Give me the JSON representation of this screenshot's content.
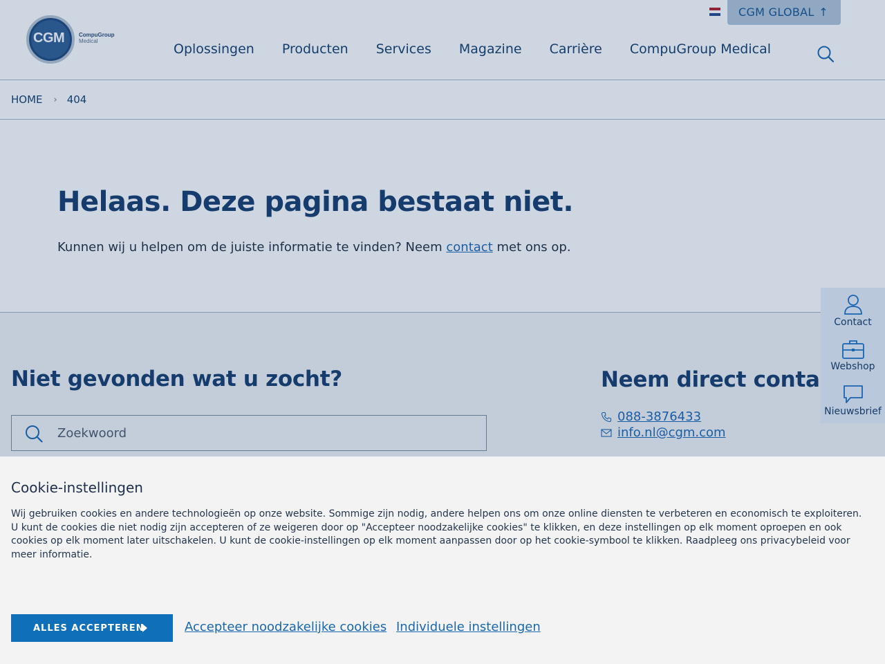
{
  "header": {
    "logo_text": "CGM",
    "logo_sub_1": "CompuGroup",
    "logo_sub_2": "Medical",
    "global_label": "CGM GLOBAL",
    "global_arrow": "↑",
    "nav": [
      {
        "label": "Oplossingen"
      },
      {
        "label": "Producten"
      },
      {
        "label": "Services"
      },
      {
        "label": "Magazine"
      },
      {
        "label": "Carrière"
      },
      {
        "label": "CompuGroup Medical"
      }
    ],
    "flag_colors": [
      "#ae1c28",
      "#ffffff",
      "#21468b"
    ]
  },
  "breadcrumb": {
    "home": "HOME",
    "separator": "›",
    "current": "404"
  },
  "hero": {
    "title": "Helaas. Deze pagina bestaat niet.",
    "text_before": "Kunnen wij u helpen om de juiste informatie te vinden? Neem ",
    "link": "contact",
    "text_after": " met ons op."
  },
  "search_section": {
    "title": "Niet gevonden wat u zocht?",
    "placeholder": "Zoekwoord"
  },
  "contact_section": {
    "title": "Neem direct contact op",
    "phone": "088-3876433",
    "email": "info.nl@cgm.com"
  },
  "side_panel": {
    "items": [
      {
        "label": "Contact",
        "icon": "person-icon"
      },
      {
        "label": "Webshop",
        "icon": "briefcase-icon"
      },
      {
        "label": "Nieuwsbrief",
        "icon": "chat-bubble-icon"
      }
    ]
  },
  "cookie": {
    "title": "Cookie-instellingen",
    "text": "Wij gebruiken cookies en andere technologieën op onze website. Sommige zijn nodig, andere helpen ons om onze online diensten te verbeteren en economisch te exploiteren. U kunt de cookies die niet nodig zijn accepteren of ze weigeren door op \"Accepteer noodzakelijke cookies\" te klikken, en deze instellingen op elk moment oproepen en ook cookies op elk moment later uitschakelen. U kunt de cookie-instellingen op elk moment aanpassen door op het cookie-symbool te klikken. Raadpleeg ons privacybeleid voor meer informatie.",
    "accept_all": "ALLES ACCEPTEREN",
    "accept_necessary": "Accepteer noodzakelijke cookies",
    "individual": "Individuele instellingen"
  },
  "colors": {
    "brand_dark": "#143a6a",
    "link": "#1b64b0",
    "button": "#0f6fb8"
  }
}
